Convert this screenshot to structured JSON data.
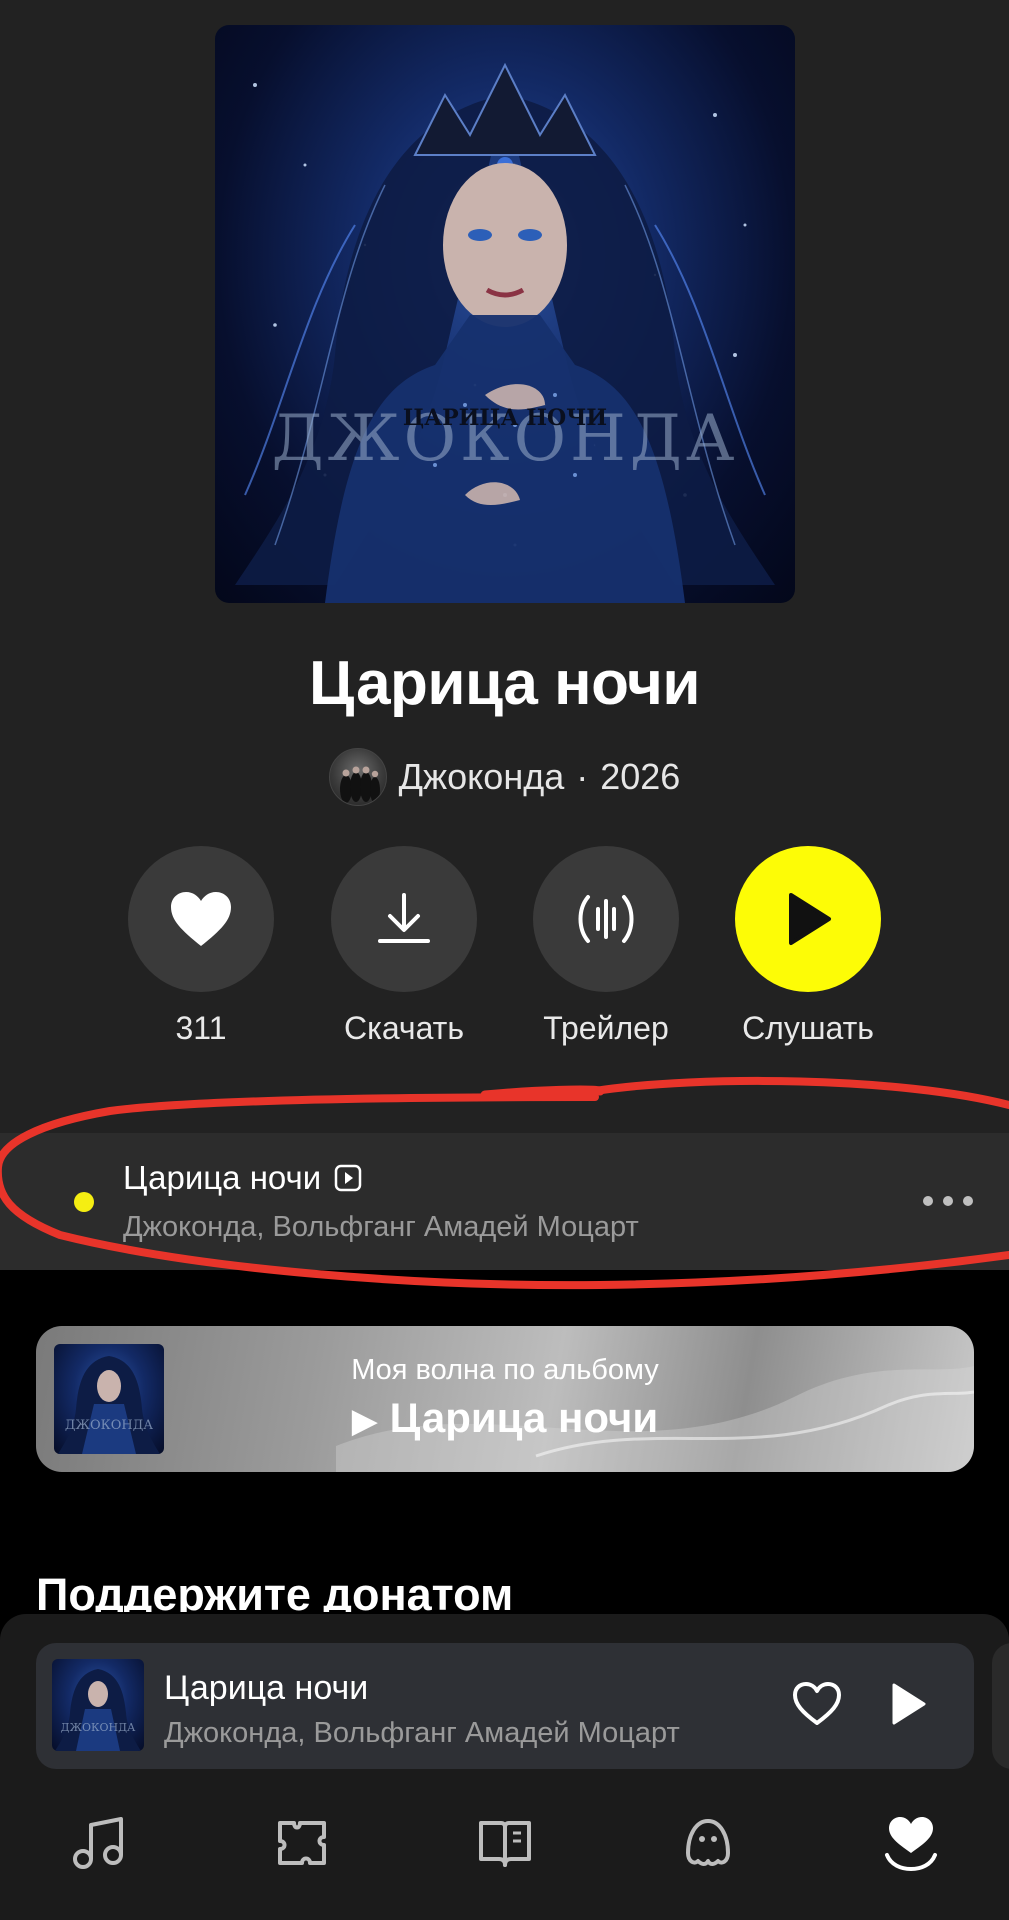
{
  "album": {
    "title": "Царица ночи",
    "artist": "Джоконда",
    "separator": "·",
    "year": "2026",
    "cover_text_main": "ДЖОКОНДА",
    "cover_text_sub": "ЦАРИЦА НОЧИ"
  },
  "actions": [
    {
      "label": "311",
      "icon": "heart-icon"
    },
    {
      "label": "Скачать",
      "icon": "download-icon"
    },
    {
      "label": "Трейлер",
      "icon": "trailer-icon"
    },
    {
      "label": "Слушать",
      "icon": "play-icon"
    }
  ],
  "track": {
    "title": "Царица ночи",
    "artists": "Джоконда, Вольфганг Амадей Моцарт",
    "badge_icon": "video-clip-icon",
    "playing_indicator_color": "#f5ee12"
  },
  "wave": {
    "subtitle": "Моя волна по альбому",
    "title": "Царица ночи",
    "play_glyph": "▶"
  },
  "section": {
    "title": "Поддержите донатом"
  },
  "mini_player": {
    "title": "Царица ночи",
    "artists": "Джоконда, Вольфганг Амадей Моцарт"
  },
  "nav": [
    {
      "icon": "music-note-icon"
    },
    {
      "icon": "map-icon"
    },
    {
      "icon": "book-icon"
    },
    {
      "icon": "kids-icon"
    },
    {
      "icon": "collection-heart-icon",
      "active": true
    }
  ],
  "colors": {
    "accent_yellow": "#fdfc06",
    "annotation_red": "#e8342a",
    "background": "#222222"
  }
}
